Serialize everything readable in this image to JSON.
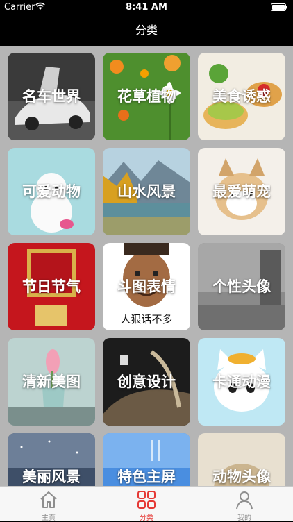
{
  "status": {
    "carrier": "Carrier",
    "time": "8:41 AM"
  },
  "navbar": {
    "title": "分类"
  },
  "categories": [
    {
      "label": "名车世界"
    },
    {
      "label": "花草植物"
    },
    {
      "label": "美食诱惑"
    },
    {
      "label": "可爱动物"
    },
    {
      "label": "山水风景"
    },
    {
      "label": "最爱萌宠"
    },
    {
      "label": "节日节气"
    },
    {
      "label": "斗图表情",
      "caption": "人狠话不多"
    },
    {
      "label": "个性头像"
    },
    {
      "label": "清新美图"
    },
    {
      "label": "创意设计"
    },
    {
      "label": "卡通动漫"
    },
    {
      "label": "美丽风景"
    },
    {
      "label": "特色主屏"
    },
    {
      "label": "动物头像"
    }
  ],
  "tabbar": {
    "items": [
      {
        "label": "主页",
        "icon": "home-icon",
        "active": false
      },
      {
        "label": "分类",
        "icon": "grid-icon",
        "active": true
      },
      {
        "label": "我的",
        "icon": "person-icon",
        "active": false
      }
    ]
  },
  "colors": {
    "accent": "#e53935",
    "tint_inactive": "#8e8e8e"
  }
}
